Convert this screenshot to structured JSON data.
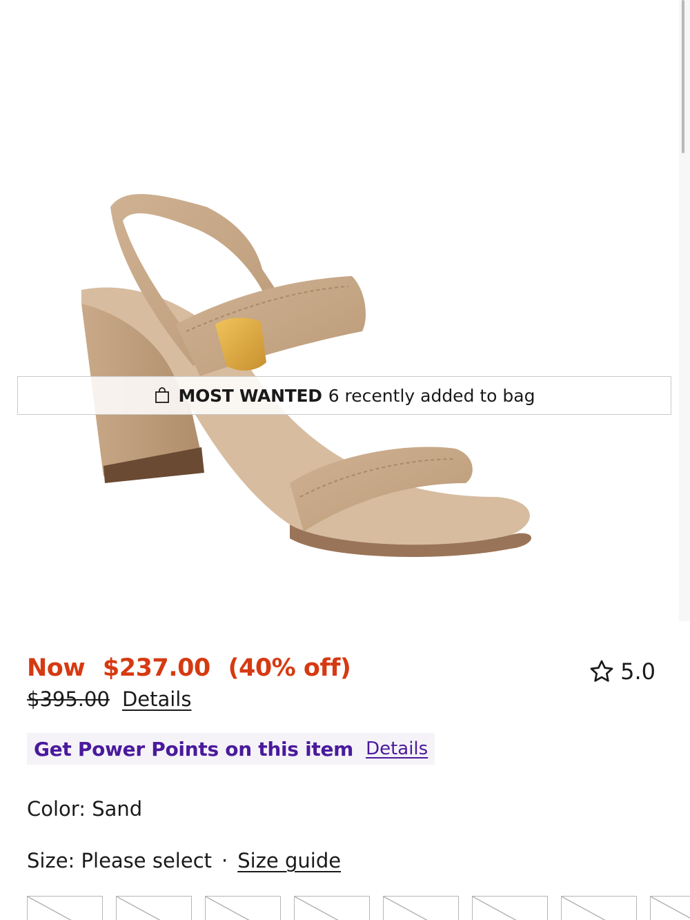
{
  "banner": {
    "icon": "shopping-bag-icon",
    "label_strong": "MOST WANTED",
    "label_rest": "6 recently added to bag"
  },
  "price": {
    "now_label": "Now",
    "now_value": "$237.00",
    "discount": "(40% off)",
    "was_value": "$395.00",
    "details_label": "Details"
  },
  "rating": {
    "icon": "star-outline-icon",
    "value": "5.0"
  },
  "points": {
    "label": "Get Power Points on this item",
    "details_label": "Details"
  },
  "color": {
    "label": "Color: Sand"
  },
  "size": {
    "label": "Size: Please select",
    "separator": "·",
    "guide_label": "Size guide",
    "option_count_visible": 8
  },
  "colors": {
    "sale_red": "#d63a12",
    "points_purple": "#4a1a9c",
    "suede": "#c8a886"
  }
}
